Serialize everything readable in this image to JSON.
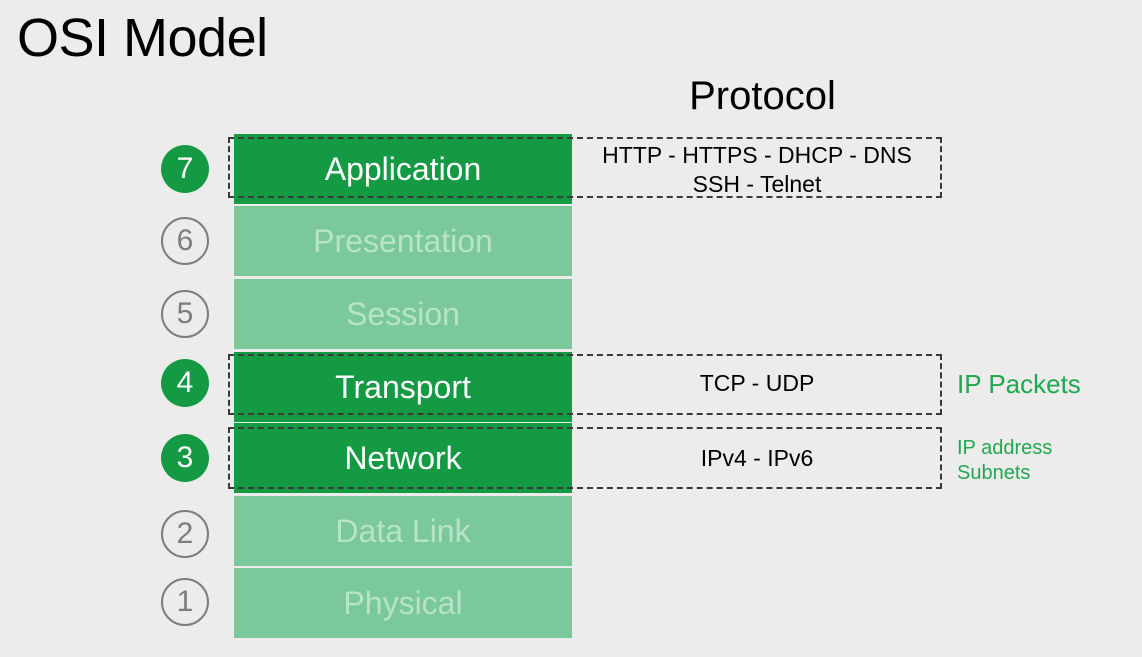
{
  "title": "OSI Model",
  "protocol_heading": "Protocol",
  "layers": [
    {
      "number": "7",
      "name": "Application",
      "active": true
    },
    {
      "number": "6",
      "name": "Presentation",
      "active": false
    },
    {
      "number": "5",
      "name": "Session",
      "active": false
    },
    {
      "number": "4",
      "name": "Transport",
      "active": true
    },
    {
      "number": "3",
      "name": "Network",
      "active": true
    },
    {
      "number": "2",
      "name": "Data Link",
      "active": false
    },
    {
      "number": "1",
      "name": "Physical",
      "active": false
    }
  ],
  "protocols": {
    "application_line1": "HTTP - HTTPS - DHCP - DNS",
    "application_line2": "SSH - Telnet",
    "transport": "TCP - UDP",
    "network": "IPv4 - IPv6"
  },
  "notes": {
    "transport": "IP Packets",
    "network_line1": "IP address",
    "network_line2": "Subnets"
  },
  "colors": {
    "active_green": "#139a43",
    "inactive_green": "#7bc99a",
    "note_green": "#1fa84f",
    "background": "#ececec"
  }
}
